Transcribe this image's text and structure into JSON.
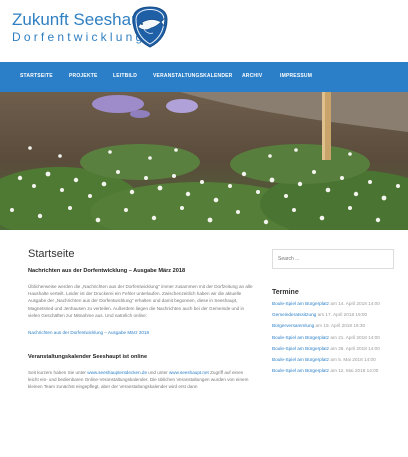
{
  "header": {
    "title": "Zukunft Seeshaupt",
    "subtitle": "Dorfentwicklung"
  },
  "nav": {
    "items": [
      "STARTSEITE",
      "PROJEKTE",
      "LEITBILD",
      "VERANSTALTUNGSKALENDER",
      "ARCHIV",
      "IMPRESSUM"
    ]
  },
  "main": {
    "heading": "Startseite",
    "article1": {
      "title": "Nachrichten aus der Dorfentwicklung – Ausgabe März 2018",
      "body": "Üblicherweise werden die „Nachrichten aus der Dorfentwicklung\" immer zusammen mit der Dorfzeitung an alle Haushalte verteilt. Leider ist der Druckerei ein Fehler unterlaufen. Zwischenzeitlich haben wir die aktuelle Ausgabe der „Nachrichten aus der Dorfentwicklung\" erhalten und damit begonnen, diese in Seeshaupt, Magnetsried und Jenhausen zu verteilen. Außerdem liegen die Nachrichten auch bei der Gemeinde und in vielen Geschäften zur Mitnahme aus. Und natürlich online:",
      "link": "Nachrichten aus der Dorfentwicklung – Ausgabe März 2018"
    },
    "article2": {
      "title": "Veranstaltungskalender Seeshaupt ist online",
      "text_1": "Seit kurzem haben Sie unter ",
      "link_1": "www.seeshauptentdecken.de",
      "text_2": " und unter ",
      "link_2": "www.seeshaupt.net",
      "text_3": " Zugriff auf einen leicht ein- und bedienbaren Online-Veranstaltungskalender. Die üblichen Veranstaltungen wurden von einem kleinen Team zunächst eingepflegt, aber der Veranstaltungskalender wird erst dann"
    }
  },
  "sidebar": {
    "search_placeholder": "Search ...",
    "termine_title": "Termine",
    "events": [
      {
        "title": "Boule-Spiel am Bürgerplatz",
        "date": "am 14. April 2018 14:00"
      },
      {
        "title": "Gemeinderatssitzung",
        "date": "am 17. April 2018 19:00"
      },
      {
        "title": "Bürgerversammlung",
        "date": "am 19. April 2018 19:30"
      },
      {
        "title": "Boule-Spiel am Bürgerplatz",
        "date": "am 21. April 2018 14:00"
      },
      {
        "title": "Boule-Spiel am Bürgerplatz",
        "date": "am 28. April 2018 14:00"
      },
      {
        "title": "Boule-Spiel am Bürgerplatz",
        "date": "am 5. Mai 2018 14:00"
      },
      {
        "title": "Boule-Spiel am Bürgerplatz",
        "date": "am 12. Mai 2018 14:00"
      }
    ]
  },
  "colors": {
    "accent": "#2b7fc8",
    "title_blue": "#2f7fc1"
  }
}
